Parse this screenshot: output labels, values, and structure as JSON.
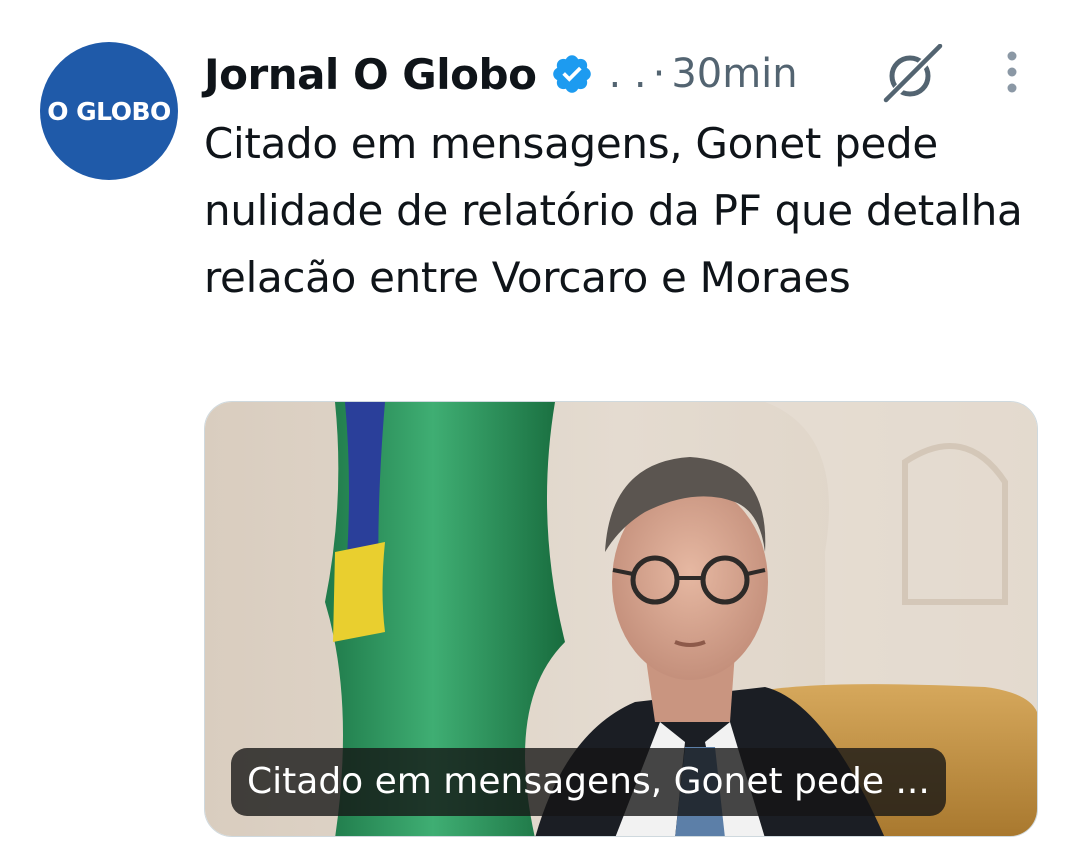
{
  "author": {
    "avatar_text": "O GLOBO",
    "name": "Jornal O Globo",
    "handle": ". .",
    "separator": "·",
    "time": "30min"
  },
  "tweet": {
    "text": "Citado em mensagens, Gonet pede nulidade de relatório da PF que detalha relacão entre Vorcaro e Moraes"
  },
  "media": {
    "caption": "Citado em mensagens, Gonet pede ..."
  },
  "icons": {
    "verified": "verified-badge-icon",
    "grok": "grok-icon",
    "more": "more-vertical-icon"
  },
  "colors": {
    "avatar_bg": "#1f5aa9",
    "verified": "#1d9bf0",
    "text": "#0f1419",
    "secondary": "#536471"
  }
}
